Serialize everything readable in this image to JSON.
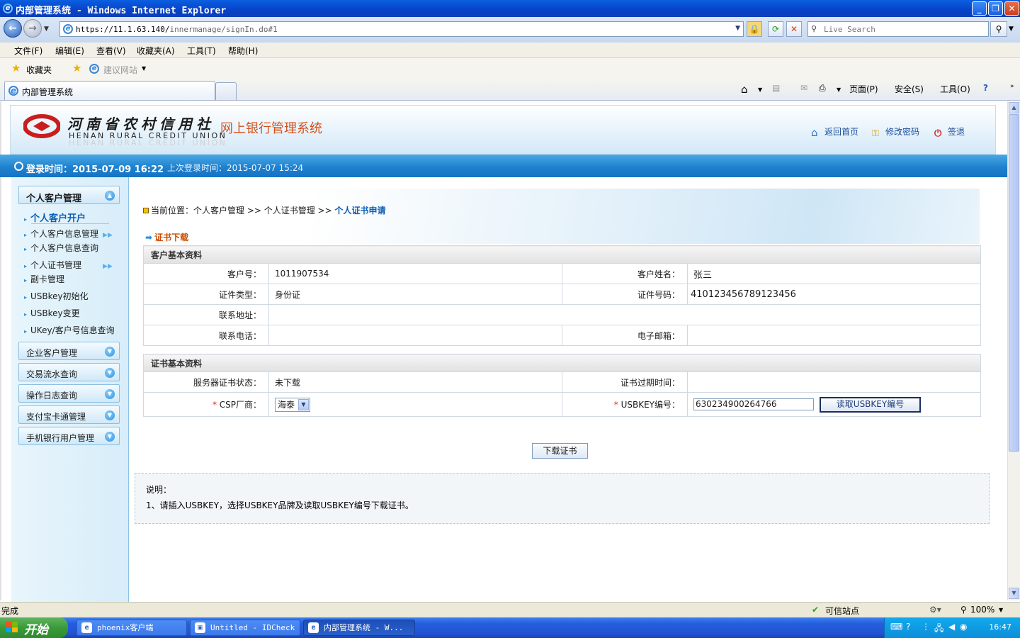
{
  "browser": {
    "title": "内部管理系统 - Windows Internet Explorer",
    "url_prefix": "https://11.1.63.140/",
    "url_rest": "innermanage/signIn.do#1",
    "search_placeholder": "Live Search",
    "menu": [
      "文件(F)",
      "编辑(E)",
      "查看(V)",
      "收藏夹(A)",
      "工具(T)",
      "帮助(H)"
    ],
    "favorites_label": "收藏夹",
    "suggested_sites": "建议网站",
    "tab_title": "内部管理系统",
    "commands": {
      "page": "页面(P)",
      "safety": "安全(S)",
      "tools": "工具(O)"
    },
    "status_left": "完成",
    "status_zone": "可信站点",
    "zoom": "100%"
  },
  "site": {
    "org_cn": "河南省农村信用社",
    "org_en": "HENAN RURAL CREDIT UNION",
    "system_name": "网上银行管理系统",
    "links": {
      "home": "返回首页",
      "change_password": "修改密码",
      "logout": "签退"
    },
    "login_time": "登录时间：2015-07-09 16:22",
    "prev_login_time": "上次登录时间：2015-07-07 15:24"
  },
  "sidebar": {
    "active_group": "个人客户管理",
    "sub_items": [
      {
        "label": "个人客户开户",
        "selected": true
      },
      {
        "label": "个人客户信息管理",
        "more": true
      },
      {
        "label": "个人客户信息查询"
      },
      {
        "label": "个人证书管理",
        "more": true
      },
      {
        "label": "副卡管理"
      },
      {
        "label": "USBkey初始化"
      },
      {
        "label": "USBkey变更"
      },
      {
        "label": "UKey/客户号信息查询"
      }
    ],
    "groups": [
      "企业客户管理",
      "交易流水查询",
      "操作日志查询",
      "支付宝卡通管理",
      "手机银行用户管理"
    ]
  },
  "breadcrumb": {
    "prefix": "当前位置：个人客户管理 >> 个人证书管理 >> ",
    "current": "个人证书申请"
  },
  "section_title": "证书下载",
  "customer": {
    "section": "客户基本资料",
    "labels": {
      "customer_no": "客户号：",
      "customer_name": "客户姓名：",
      "id_type": "证件类型：",
      "id_no": "证件号码：",
      "address": "联系地址：",
      "phone": "联系电话：",
      "email": "电子邮箱："
    },
    "values": {
      "customer_no": "1011907534",
      "customer_name": "张三",
      "id_type": "身份证",
      "id_no": "410123456789123456",
      "address": "",
      "phone": "",
      "email": ""
    }
  },
  "certificate": {
    "section": "证书基本资料",
    "labels": {
      "server_status": "服务器证书状态：",
      "expiry": "证书过期时间：",
      "csp": "CSP厂商：",
      "usbkey": "USBKEY编号："
    },
    "values": {
      "server_status": "未下载",
      "expiry": "",
      "csp": "海泰",
      "usbkey": "630234900264766"
    },
    "read_button": "读取USBKEY编号"
  },
  "download_button": "下载证书",
  "note": {
    "heading": "说明：",
    "line1": "1、请插入USBKEY，选择USBKEY品牌及读取USBKEY编号下载证书。"
  },
  "taskbar": {
    "start": "开始",
    "tasks": [
      "phoenix客户端",
      "Untitled - IDCheck",
      "内部管理系统 - W..."
    ],
    "time": "16:47"
  }
}
